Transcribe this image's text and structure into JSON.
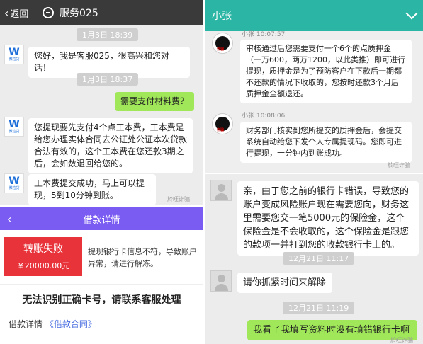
{
  "panel_a": {
    "back_label": "返回",
    "title": "服务025",
    "logo_letter": "W",
    "logo_name": "微粒贷",
    "time1": "1月3日 18:39",
    "msg1": "您好，我是客服025，很高兴和您对话！",
    "time2": "1月3日 18:37",
    "msg2": "需要支付材料费？",
    "msg3": "您提现要先支付4个点工本费，工本费是给您办理实体合同去公证处公证本次贷款合法有效的，这个工本费在您还款3期之后，会如数退回给您的。",
    "msg4": "工本费提交成功，马上可以提现，5到10分钟到账。",
    "watermark": "於旺诈骗"
  },
  "panel_b": {
    "title": "小张",
    "sender1": "小张  10:07:57",
    "msg1": "审核通过后您需要支付一个6个的点质押金（一万600，两万1200，以此类推）即可进行提现，质押金是为了预防客户在下款后一期都不还款的情况下收取的，您按时还款3个月后质押金全额退还。",
    "sender2": "小张  10:08:06",
    "msg2": "财务部门核实到您所提交的质押金后，会提交系统自动给您下发个人专属提现码。您即可进行提现，十分钟内到账成功。",
    "avatar_tag": "诈骗",
    "watermark": "於旺诈骗"
  },
  "panel_c": {
    "title": "借款详情",
    "status": "转账失败",
    "amount": "￥20000.00元",
    "fail_reason": "提现银行卡信息不符，导致账户异常，请进行解冻。",
    "error": "无法识别正确卡号，请联系客服处理",
    "link_prefix": "借款详情",
    "link_text": "《借款合同》"
  },
  "panel_d": {
    "msg1": "亲，由于您之前的银行卡错误，导致您的账户变成风险账户现在需要您向，财务这里需要您交一笔5000元的保险金，这个保险金是不会收取的，这个保险金是跟您的款项一并打到您的收款银行卡上的。",
    "time1": "12月21日 11:17",
    "msg2": "请你抓紧时间来解除",
    "time2": "12月21日 11:19",
    "msg3": "我看了我填写资料时没有填错银行卡啊",
    "watermark": "於旺诈骗"
  }
}
